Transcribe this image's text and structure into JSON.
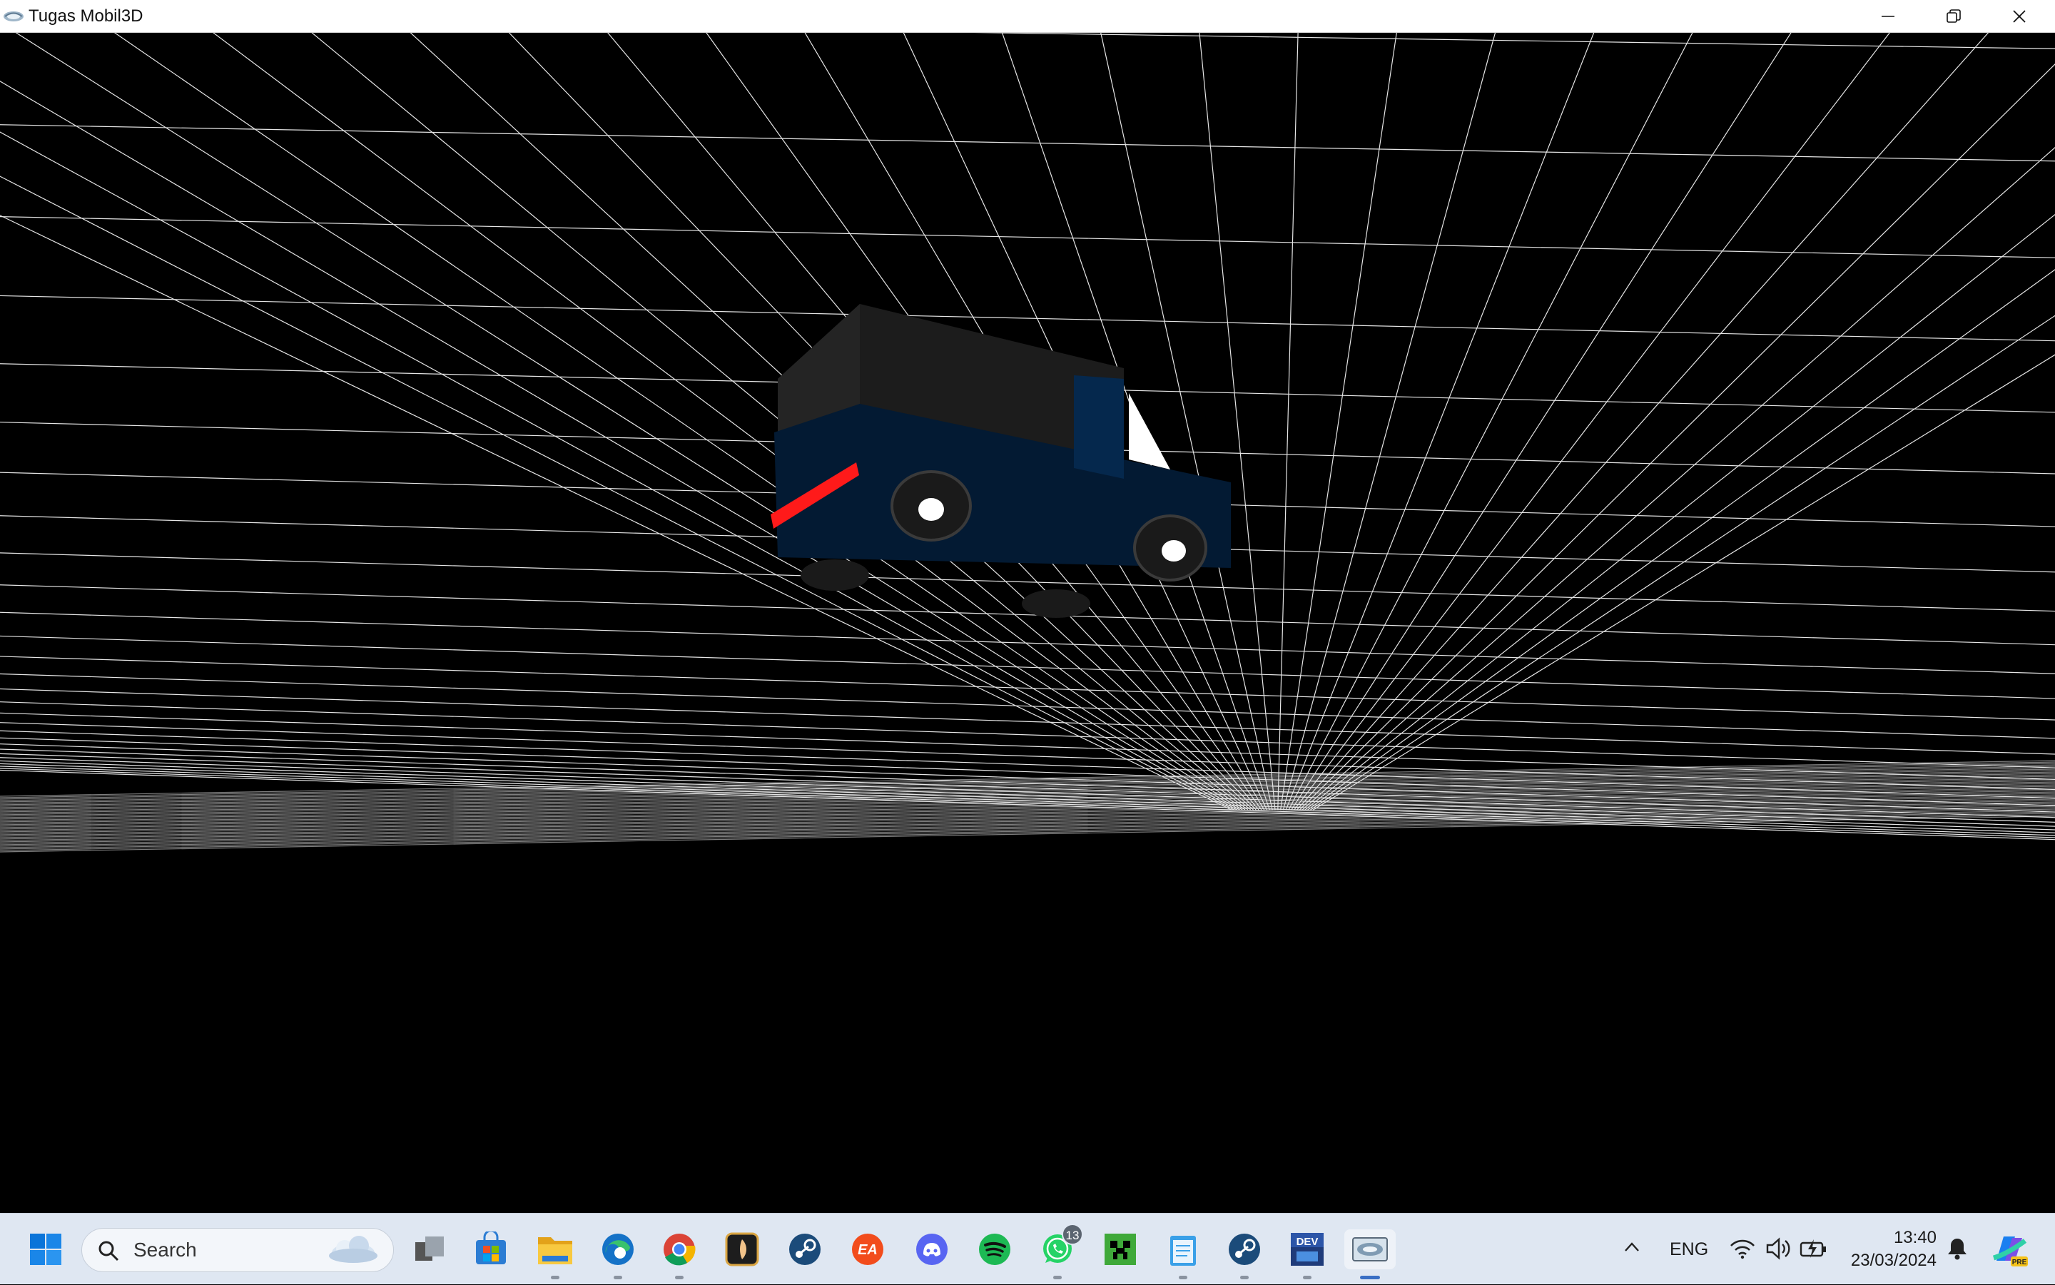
{
  "window": {
    "title": "Tugas Mobil3D",
    "icon": "opengl-app-icon",
    "controls": [
      "minimize-icon",
      "restore-icon",
      "close-icon"
    ]
  },
  "viewport": {
    "background": "#000000",
    "grid_color": "#ffffff",
    "car": {
      "body_color": "#031a33",
      "cabin_color": "#1c1c1c",
      "light_bar_color": "#ff1a1a",
      "windshield_color": "#ffffff",
      "wheel_color": "#1a1a1a",
      "hubcap_color": "#ffffff"
    }
  },
  "taskbar": {
    "search": {
      "label": "Search"
    },
    "apps": [
      {
        "icon": "windows-start-icon",
        "running": false
      },
      {
        "icon": "task-view-icon",
        "running": false
      },
      {
        "icon": "microsoft-store-icon",
        "running": false
      },
      {
        "icon": "file-explorer-icon",
        "running": true
      },
      {
        "icon": "edge-icon",
        "running": true
      },
      {
        "icon": "chrome-icon",
        "running": true
      },
      {
        "icon": "app-pen-icon",
        "running": false
      },
      {
        "icon": "steam-icon",
        "running": false
      },
      {
        "icon": "ea-icon",
        "running": false
      },
      {
        "icon": "discord-icon",
        "running": false
      },
      {
        "icon": "spotify-icon",
        "running": false
      },
      {
        "icon": "whatsapp-icon",
        "running": true,
        "badge": "13"
      },
      {
        "icon": "minecraft-icon",
        "running": false
      },
      {
        "icon": "notepad-icon",
        "running": true
      },
      {
        "icon": "steam-icon",
        "running": true
      },
      {
        "icon": "devcpp-icon",
        "running": true
      },
      {
        "icon": "opengl-app-icon",
        "running": true,
        "active": true
      }
    ],
    "tray": {
      "language": "ENG",
      "time": "13:40",
      "date": "23/03/2024"
    }
  }
}
